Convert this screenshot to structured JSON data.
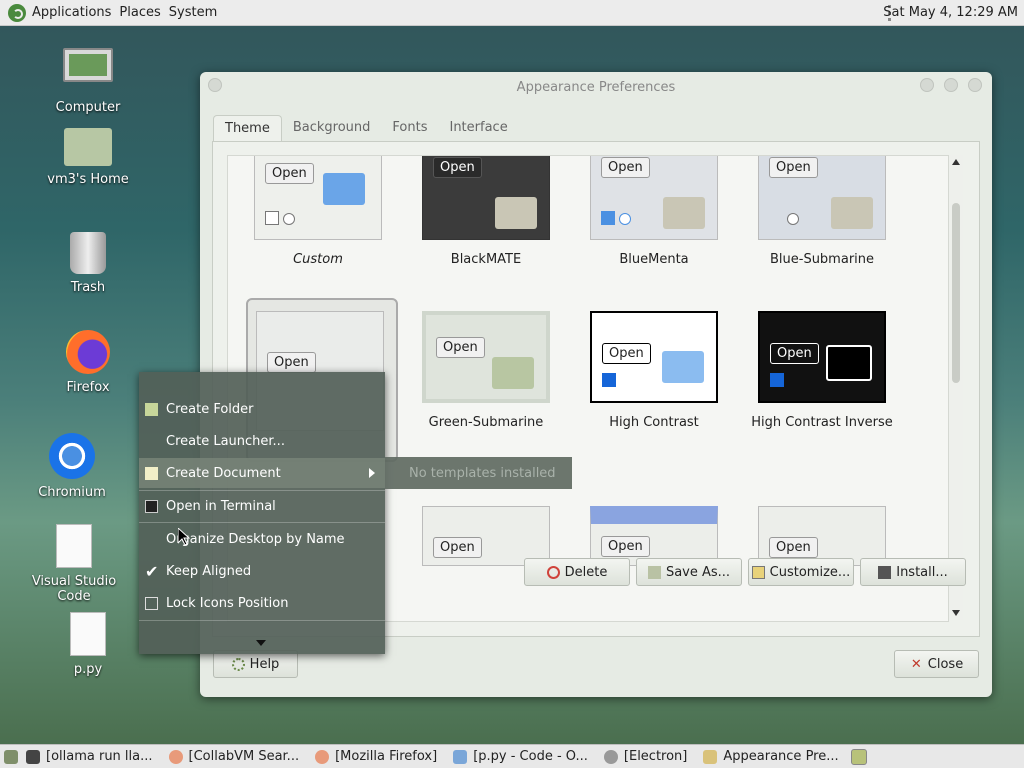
{
  "top_panel": {
    "menus": [
      "Applications",
      "Places",
      "System"
    ],
    "clock": "Sat May  4, 12:29 AM"
  },
  "desktop_icons": [
    {
      "label": "Computer",
      "icon": "computer-icon"
    },
    {
      "label": "vm3's Home",
      "icon": "home-folder-icon"
    },
    {
      "label": "Trash",
      "icon": "trash-icon"
    },
    {
      "label": "Firefox",
      "icon": "firefox-icon"
    },
    {
      "label": "Chromium",
      "icon": "chromium-icon"
    },
    {
      "label": "Visual Studio Code",
      "icon": "document-icon"
    },
    {
      "label": "p.py",
      "icon": "document-icon"
    }
  ],
  "window": {
    "title": "Appearance Preferences",
    "tabs": [
      "Theme",
      "Background",
      "Fonts",
      "Interface"
    ],
    "active_tab": "Theme",
    "themes": [
      {
        "name": "Custom",
        "open_label": "Open"
      },
      {
        "name": "BlackMATE",
        "open_label": "Open"
      },
      {
        "name": "BlueMenta",
        "open_label": "Open"
      },
      {
        "name": "Blue-Submarine",
        "open_label": "Open"
      },
      {
        "name": "",
        "open_label": "Open"
      },
      {
        "name": "Green-Submarine",
        "open_label": "Open"
      },
      {
        "name": "High Contrast",
        "open_label": "Open"
      },
      {
        "name": "High Contrast Inverse",
        "open_label": "Open"
      },
      {
        "name": "",
        "open_label": "Open"
      },
      {
        "name": "",
        "open_label": "Open"
      },
      {
        "name": "",
        "open_label": "Open"
      }
    ],
    "buttons": {
      "delete": "Delete",
      "save_as": "Save As...",
      "customize": "Customize...",
      "install": "Install...",
      "help": "Help",
      "close": "Close"
    }
  },
  "context_menu": {
    "items": [
      {
        "label": "Create Folder",
        "icon": "folder-new-icon"
      },
      {
        "label": "Create Launcher...",
        "icon": ""
      },
      {
        "label": "Create Document",
        "icon": "document-new-icon",
        "submenu": true
      },
      {
        "label": "Open in Terminal",
        "icon": "terminal-icon"
      },
      {
        "label": "Organize Desktop by Name",
        "icon": ""
      },
      {
        "label": "Keep Aligned",
        "icon": "checkmark-icon",
        "checked": true
      },
      {
        "label": "Lock Icons Position",
        "icon": "checkbox-icon",
        "checked": false
      }
    ],
    "submenu_text": "No templates installed"
  },
  "taskbar": {
    "tasks": [
      {
        "label": "[ollama run lla...",
        "icon": "terminal-icon"
      },
      {
        "label": "[CollabVM Sear...",
        "icon": "firefox-icon"
      },
      {
        "label": "[Mozilla Firefox]",
        "icon": "firefox-icon"
      },
      {
        "label": "[p.py - Code - O...",
        "icon": "vscode-icon"
      },
      {
        "label": "[Electron]",
        "icon": "electron-icon"
      },
      {
        "label": "Appearance Pre...",
        "icon": "appearance-icon",
        "active": true
      }
    ]
  },
  "colors": {
    "window_bg": "#e6ebe4",
    "menu_bg": "#525f58",
    "accent_blue": "#1565d8"
  }
}
